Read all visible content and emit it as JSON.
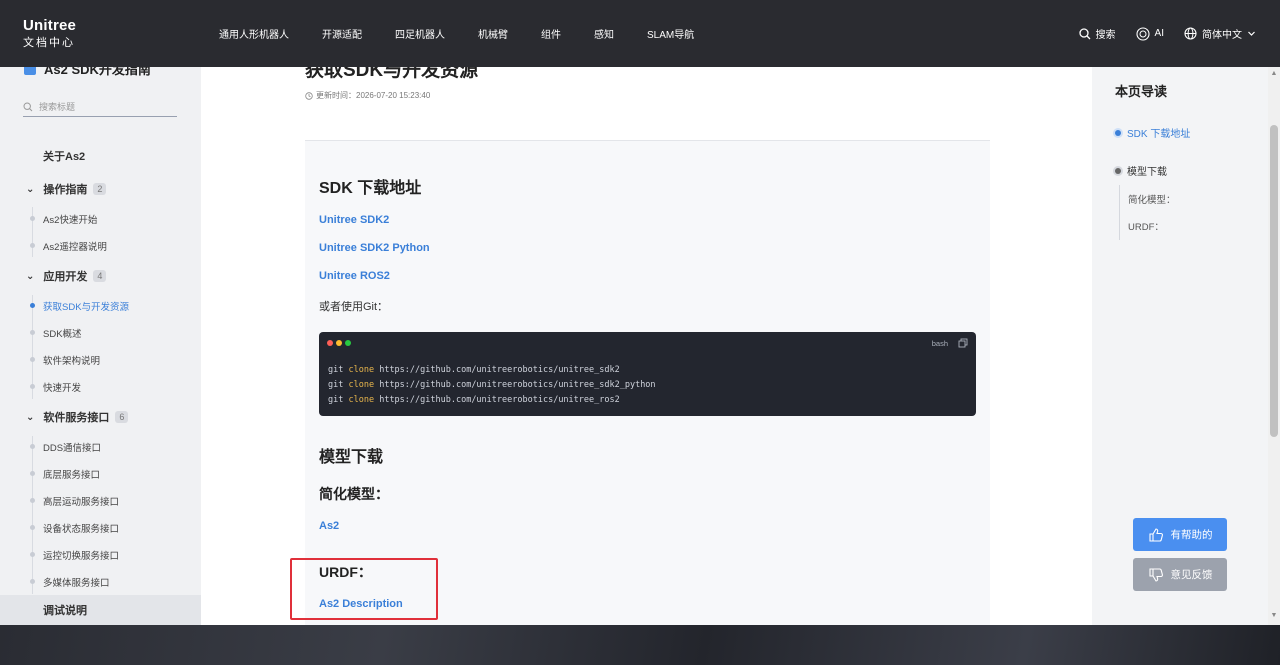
{
  "header": {
    "logo_line1": "Unitree",
    "logo_line2": "文档中心",
    "nav": [
      "通用人形机器人",
      "开源适配",
      "四足机器人",
      "机械臂",
      "组件",
      "感知",
      "SLAM导航"
    ],
    "search_label": "搜索",
    "ai_label": "AI",
    "language_label": "简体中文"
  },
  "sidebar": {
    "title": "As2 SDK开发指南",
    "search_placeholder": "搜索标题",
    "about": "关于As2",
    "sections": [
      {
        "label": "操作指南",
        "count": "2",
        "children": [
          "As2快速开始",
          "As2遥控器说明"
        ]
      },
      {
        "label": "应用开发",
        "count": "4",
        "children": [
          "获取SDK与开发资源",
          "SDK概述",
          "软件架构说明",
          "快速开发"
        ]
      },
      {
        "label": "软件服务接口",
        "count": "6",
        "children": [
          "DDS通信接口",
          "底层服务接口",
          "高层运动服务接口",
          "设备状态服务接口",
          "运控切换服务接口",
          "多媒体服务接口"
        ]
      }
    ],
    "active_item": "获取SDK与开发资源",
    "bottom_item": "调试说明"
  },
  "main": {
    "title": "获取SDK与开发资源",
    "updated": "更新时间：2026-07-20 15:23:40",
    "sdk_heading": "SDK 下载地址",
    "links": [
      "Unitree SDK2",
      "Unitree SDK2 Python",
      "Unitree ROS2"
    ],
    "git_text": "或者使用Git：",
    "code_lang": "bash",
    "code_lines": [
      {
        "cmd": "git",
        "kw": "clone",
        "url": "https://github.com/unitreerobotics/unitree_sdk2"
      },
      {
        "cmd": "git",
        "kw": "clone",
        "url": "https://github.com/unitreerobotics/unitree_sdk2_python"
      },
      {
        "cmd": "git",
        "kw": "clone",
        "url": "https://github.com/unitreerobotics/unitree_ros2"
      }
    ],
    "model_heading": "模型下载",
    "simplified_heading": "简化模型：",
    "simplified_link": "As2",
    "urdf_heading": "URDF：",
    "urdf_link": "As2 Description"
  },
  "toc": {
    "title": "本页导读",
    "items": [
      "SDK 下载地址",
      "模型下载"
    ],
    "sub_items": [
      "简化模型：",
      "URDF："
    ]
  },
  "feedback": {
    "helpful": "有帮助的",
    "feedback": "意见反馈"
  },
  "colors": {
    "accent": "#3a7fd8",
    "header_bg": "#2a2b30",
    "highlight_box": "#e0303a"
  }
}
